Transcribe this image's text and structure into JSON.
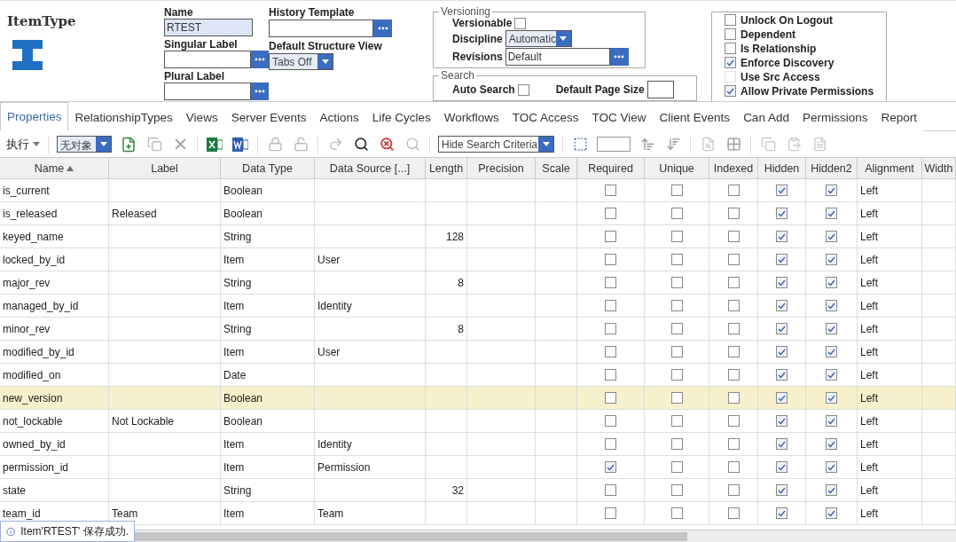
{
  "item_type": {
    "title": "ItemType"
  },
  "form": {
    "name": {
      "label": "Name",
      "value": "RTEST"
    },
    "history_template": {
      "label": "History Template"
    },
    "singular_label": {
      "label": "Singular Label"
    },
    "default_structure_view": {
      "label": "Default Structure View",
      "value": "Tabs Off"
    },
    "plural_label": {
      "label": "Plural Label"
    }
  },
  "versioning": {
    "legend": "Versioning",
    "versionable": {
      "label": "Versionable",
      "checked": false
    },
    "discipline": {
      "label": "Discipline",
      "value": "Automatic"
    },
    "revisions": {
      "label": "Revisions",
      "value": "Default"
    }
  },
  "search": {
    "legend": "Search",
    "auto_search": {
      "label": "Auto Search",
      "checked": false
    },
    "default_page_size": {
      "label": "Default Page Size"
    }
  },
  "options": [
    {
      "label": "Unlock On Logout",
      "checked": false,
      "disabled": false
    },
    {
      "label": "Dependent",
      "checked": false,
      "disabled": false
    },
    {
      "label": "Is Relationship",
      "checked": false,
      "disabled": false
    },
    {
      "label": "Enforce Discovery",
      "checked": true,
      "disabled": false
    },
    {
      "label": "Use Src Access",
      "checked": false,
      "disabled": true
    },
    {
      "label": "Allow Private Permissions",
      "checked": true,
      "disabled": false
    }
  ],
  "tabs": [
    {
      "label": "Properties",
      "selected": true
    },
    {
      "label": "RelationshipTypes",
      "selected": false
    },
    {
      "label": "Views",
      "selected": false
    },
    {
      "label": "Server Events",
      "selected": false
    },
    {
      "label": "Actions",
      "selected": false
    },
    {
      "label": "Life Cycles",
      "selected": false
    },
    {
      "label": "Workflows",
      "selected": false
    },
    {
      "label": "TOC Access",
      "selected": false
    },
    {
      "label": "TOC View",
      "selected": false
    },
    {
      "label": "Client Events",
      "selected": false
    },
    {
      "label": "Can Add",
      "selected": false
    },
    {
      "label": "Permissions",
      "selected": false
    },
    {
      "label": "Report",
      "selected": false
    }
  ],
  "toolbar": {
    "action_menu": "执行",
    "item_select": "无对象",
    "search_mode": "Hide Search Criteria"
  },
  "table": {
    "columns": [
      {
        "title": "Name",
        "sorted": true
      },
      {
        "title": "Label",
        "sorted": false
      },
      {
        "title": "Data Type",
        "sorted": false
      },
      {
        "title": "Data Source [...]",
        "sorted": false
      },
      {
        "title": "Length",
        "sorted": false
      },
      {
        "title": "Precision",
        "sorted": false
      },
      {
        "title": "Scale",
        "sorted": false
      },
      {
        "title": "Required",
        "sorted": false
      },
      {
        "title": "Unique",
        "sorted": false
      },
      {
        "title": "Indexed",
        "sorted": false
      },
      {
        "title": "Hidden",
        "sorted": false
      },
      {
        "title": "Hidden2",
        "sorted": false
      },
      {
        "title": "Alignment",
        "sorted": false
      },
      {
        "title": "Width",
        "sorted": false
      }
    ],
    "rows": [
      {
        "name": "is_current",
        "data_type": "Boolean",
        "required": false,
        "unique": false,
        "indexed": false,
        "hidden": true,
        "hidden2": true,
        "alignment": "Left",
        "selected": false
      },
      {
        "name": "is_released",
        "label": "Released",
        "data_type": "Boolean",
        "required": false,
        "unique": false,
        "indexed": false,
        "hidden": true,
        "hidden2": true,
        "alignment": "Left",
        "selected": false
      },
      {
        "name": "keyed_name",
        "data_type": "String",
        "length": "128",
        "required": false,
        "unique": false,
        "indexed": false,
        "hidden": true,
        "hidden2": true,
        "alignment": "Left",
        "selected": false
      },
      {
        "name": "locked_by_id",
        "data_type": "Item",
        "data_source": "User",
        "required": false,
        "unique": false,
        "indexed": false,
        "hidden": true,
        "hidden2": true,
        "alignment": "Left",
        "selected": false
      },
      {
        "name": "major_rev",
        "data_type": "String",
        "length": "8",
        "required": false,
        "unique": false,
        "indexed": false,
        "hidden": true,
        "hidden2": true,
        "alignment": "Left",
        "selected": false
      },
      {
        "name": "managed_by_id",
        "data_type": "Item",
        "data_source": "Identity",
        "required": false,
        "unique": false,
        "indexed": false,
        "hidden": true,
        "hidden2": true,
        "alignment": "Left",
        "selected": false
      },
      {
        "name": "minor_rev",
        "data_type": "String",
        "length": "8",
        "required": false,
        "unique": false,
        "indexed": false,
        "hidden": true,
        "hidden2": true,
        "alignment": "Left",
        "selected": false
      },
      {
        "name": "modified_by_id",
        "data_type": "Item",
        "data_source": "User",
        "required": false,
        "unique": false,
        "indexed": false,
        "hidden": true,
        "hidden2": true,
        "alignment": "Left",
        "selected": false
      },
      {
        "name": "modified_on",
        "data_type": "Date",
        "required": false,
        "unique": false,
        "indexed": false,
        "hidden": true,
        "hidden2": true,
        "alignment": "Left",
        "selected": false
      },
      {
        "name": "new_version",
        "data_type": "Boolean",
        "required": false,
        "unique": false,
        "indexed": false,
        "hidden": true,
        "hidden2": true,
        "alignment": "Left",
        "selected": true
      },
      {
        "name": "not_lockable",
        "label": "Not Lockable",
        "data_type": "Boolean",
        "required": false,
        "unique": false,
        "indexed": false,
        "hidden": true,
        "hidden2": true,
        "alignment": "Left",
        "selected": false
      },
      {
        "name": "owned_by_id",
        "data_type": "Item",
        "data_source": "Identity",
        "required": false,
        "unique": false,
        "indexed": false,
        "hidden": true,
        "hidden2": true,
        "alignment": "Left",
        "selected": false
      },
      {
        "name": "permission_id",
        "data_type": "Item",
        "data_source": "Permission",
        "required": true,
        "unique": false,
        "indexed": false,
        "hidden": true,
        "hidden2": true,
        "alignment": "Left",
        "selected": false
      },
      {
        "name": "state",
        "data_type": "String",
        "length": "32",
        "required": false,
        "unique": false,
        "indexed": false,
        "hidden": true,
        "hidden2": true,
        "alignment": "Left",
        "selected": false
      },
      {
        "name": "team_id",
        "label": "Team",
        "data_type": "Item",
        "data_source": "Team",
        "required": false,
        "unique": false,
        "indexed": false,
        "hidden": true,
        "hidden2": true,
        "alignment": "Left",
        "selected": false
      }
    ]
  },
  "toast": {
    "message": "Item'RTEST' 保存成功."
  }
}
